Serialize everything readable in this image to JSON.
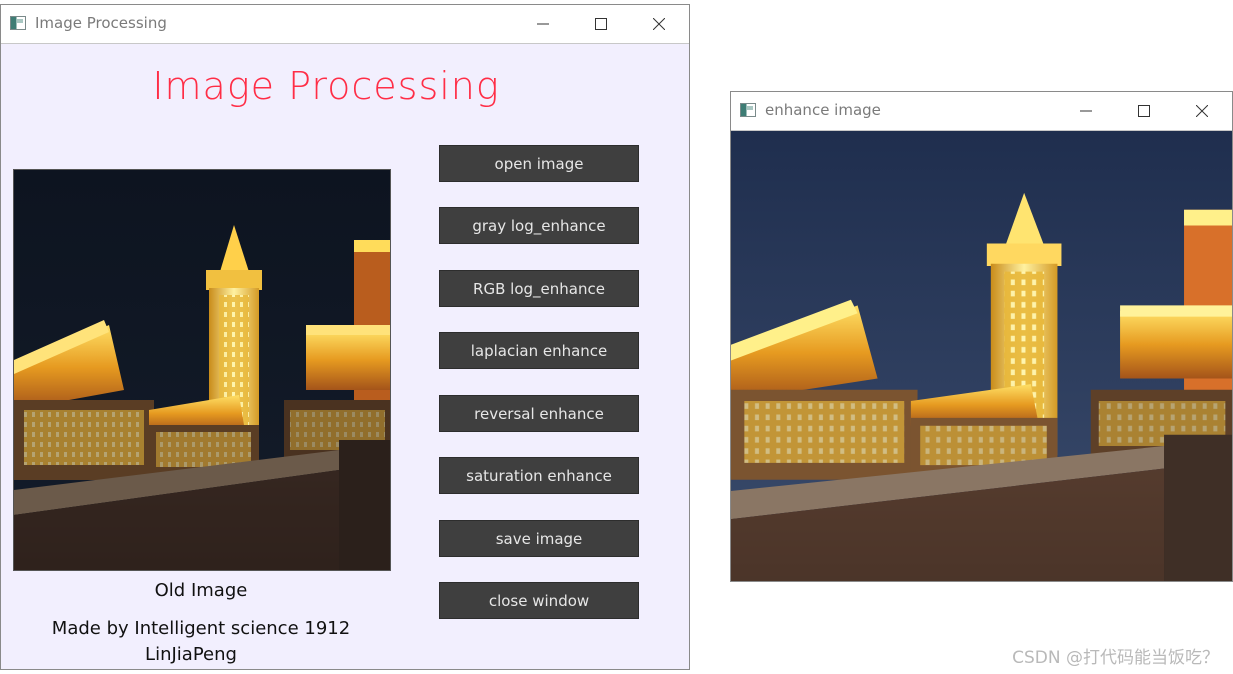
{
  "main_window": {
    "title": "Image Processing",
    "heading": "Image Processing",
    "old_image_caption": "Old Image",
    "credit_line1": "Made by Intelligent science 1912",
    "credit_line2": "LinJiaPeng",
    "buttons": [
      {
        "label": "open image"
      },
      {
        "label": "gray log_enhance"
      },
      {
        "label": "RGB log_enhance"
      },
      {
        "label": "laplacian enhance"
      },
      {
        "label": "reversal enhance"
      },
      {
        "label": "saturation enhance"
      },
      {
        "label": "save image"
      },
      {
        "label": "close window"
      }
    ]
  },
  "enhance_window": {
    "title": "enhance image"
  },
  "watermark": "CSDN @打代码能当饭吃？",
  "colors": {
    "heading": "#ff2d46",
    "client_bg": "#f2effe",
    "button_bg": "#3f3f3f",
    "button_text": "#e6e6e6"
  }
}
